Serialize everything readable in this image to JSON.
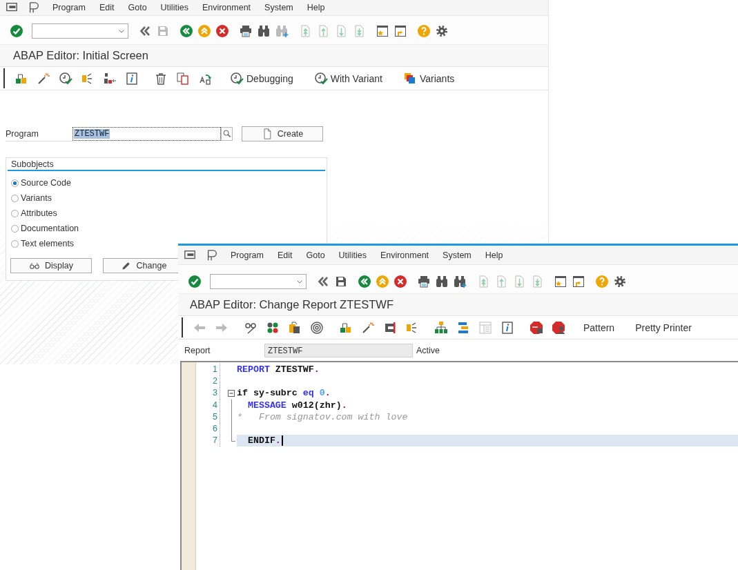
{
  "background_window": {
    "menu": [
      "Program",
      "Edit",
      "Goto",
      "Utilities",
      "Environment",
      "System",
      "Help"
    ],
    "title": "ABAP Editor: Initial Screen",
    "toolbar_buttons": [
      {
        "label": "Debugging"
      },
      {
        "label": "With Variant"
      },
      {
        "label": "Variants"
      }
    ],
    "program_field": {
      "label": "Program",
      "value": "ZTESTWF"
    },
    "create_button": "Create",
    "subobjects": {
      "title": "Subobjects",
      "options": [
        {
          "label": "Source Code",
          "selected": true
        },
        {
          "label": "Variants",
          "selected": false
        },
        {
          "label": "Attributes",
          "selected": false
        },
        {
          "label": "Documentation",
          "selected": false
        },
        {
          "label": "Text elements",
          "selected": false
        }
      ]
    },
    "buttons": [
      "Display",
      "Change"
    ]
  },
  "editor_window": {
    "menu": [
      "Program",
      "Edit",
      "Goto",
      "Utilities",
      "Environment",
      "System",
      "Help"
    ],
    "title": "ABAP Editor: Change Report ZTESTWF",
    "toolbar_buttons": [
      {
        "label": "Pattern"
      },
      {
        "label": "Pretty Printer"
      }
    ],
    "report_field": {
      "label": "Report",
      "value": "ZTESTWF",
      "status": "Active"
    },
    "code_lines": [
      {
        "number": "1",
        "kind": "plain",
        "current": false,
        "tokens": [
          {
            "kind": "keyword",
            "text": "REPORT"
          },
          {
            "kind": "plain",
            "text": " ZTESTWF"
          },
          {
            "kind": "punct",
            "text": "."
          }
        ]
      },
      {
        "number": "2",
        "kind": "plain",
        "current": false
      },
      {
        "number": "3",
        "kind": "fold-start",
        "current": false,
        "tokens": [
          {
            "kind": "plain",
            "text": "if sy-subrc "
          },
          {
            "kind": "keyword",
            "text": "eq"
          },
          {
            "kind": "number",
            "text": " 0"
          },
          {
            "kind": "punct",
            "text": "."
          }
        ]
      },
      {
        "number": "4",
        "kind": "fold-body",
        "current": false,
        "tokens": [
          {
            "kind": "keyword",
            "text": "  MESSAGE"
          },
          {
            "kind": "plain",
            "text": " w012(zhr)"
          },
          {
            "kind": "punct",
            "text": "."
          }
        ]
      },
      {
        "number": "5",
        "kind": "fold-body",
        "current": false,
        "tokens": [
          {
            "kind": "comment",
            "text": "*   From signatov.com with love"
          }
        ]
      },
      {
        "number": "6",
        "kind": "fold-body",
        "current": false
      },
      {
        "number": "7",
        "kind": "fold-end",
        "current": true,
        "tokens": [
          {
            "kind": "plain",
            "text": "  ENDIF"
          },
          {
            "kind": "punct",
            "text": "."
          }
        ]
      }
    ]
  }
}
